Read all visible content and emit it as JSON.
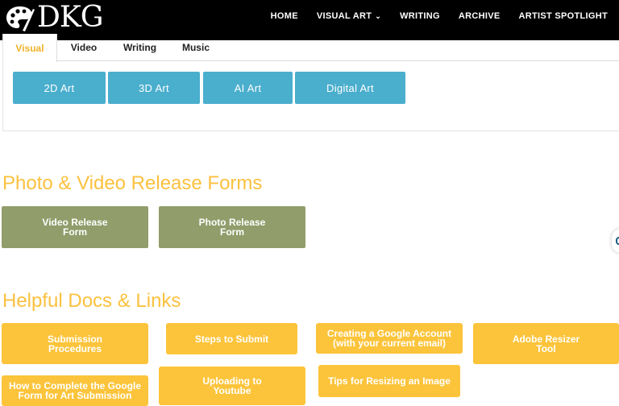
{
  "header": {
    "logo_text": "DKG",
    "nav": [
      {
        "label": "HOME",
        "has_dropdown": false
      },
      {
        "label": "VISUAL ART",
        "has_dropdown": true
      },
      {
        "label": "WRITING",
        "has_dropdown": false
      },
      {
        "label": "ARCHIVE",
        "has_dropdown": false
      },
      {
        "label": "ARTIST SPOTLIGHT",
        "has_dropdown": false
      }
    ]
  },
  "tabs": {
    "items": [
      "Visual",
      "Video",
      "Writing",
      "Music"
    ],
    "active": "Visual",
    "buttons": [
      "2D Art",
      "3D Art",
      "AI Art",
      "Digital Art"
    ]
  },
  "release_forms": {
    "title": "Photo & Video Release Forms",
    "buttons": [
      {
        "line1": "Video Release",
        "line2": "Form"
      },
      {
        "line1": "Photo Release",
        "line2": "Form"
      }
    ]
  },
  "helpful": {
    "title": "Helpful Docs & Links",
    "buttons": [
      {
        "line1": "Submission",
        "line2": "Procedures"
      },
      {
        "line1": "Steps to Submit",
        "line2": ""
      },
      {
        "line1": "Creating a Google Account",
        "line2": "(with your current email)"
      },
      {
        "line1": "Adobe Resizer",
        "line2": "Tool"
      },
      {
        "line1": "How to Complete the Google",
        "line2": "Form for Art Submission"
      },
      {
        "line1": "Uploading to",
        "line2": "Youtube"
      },
      {
        "line1": "Tips for Resizing an Image",
        "line2": ""
      }
    ]
  },
  "colors": {
    "header_bg": "#000000",
    "accent_yellow": "#fcc43b",
    "tab_button_blue": "#4aaecd",
    "release_green": "#919d6b"
  },
  "icons": {
    "logo": "palette-logo-icon",
    "dropdown": "chevron-down-icon",
    "side_widget": "accessibility-icon"
  }
}
